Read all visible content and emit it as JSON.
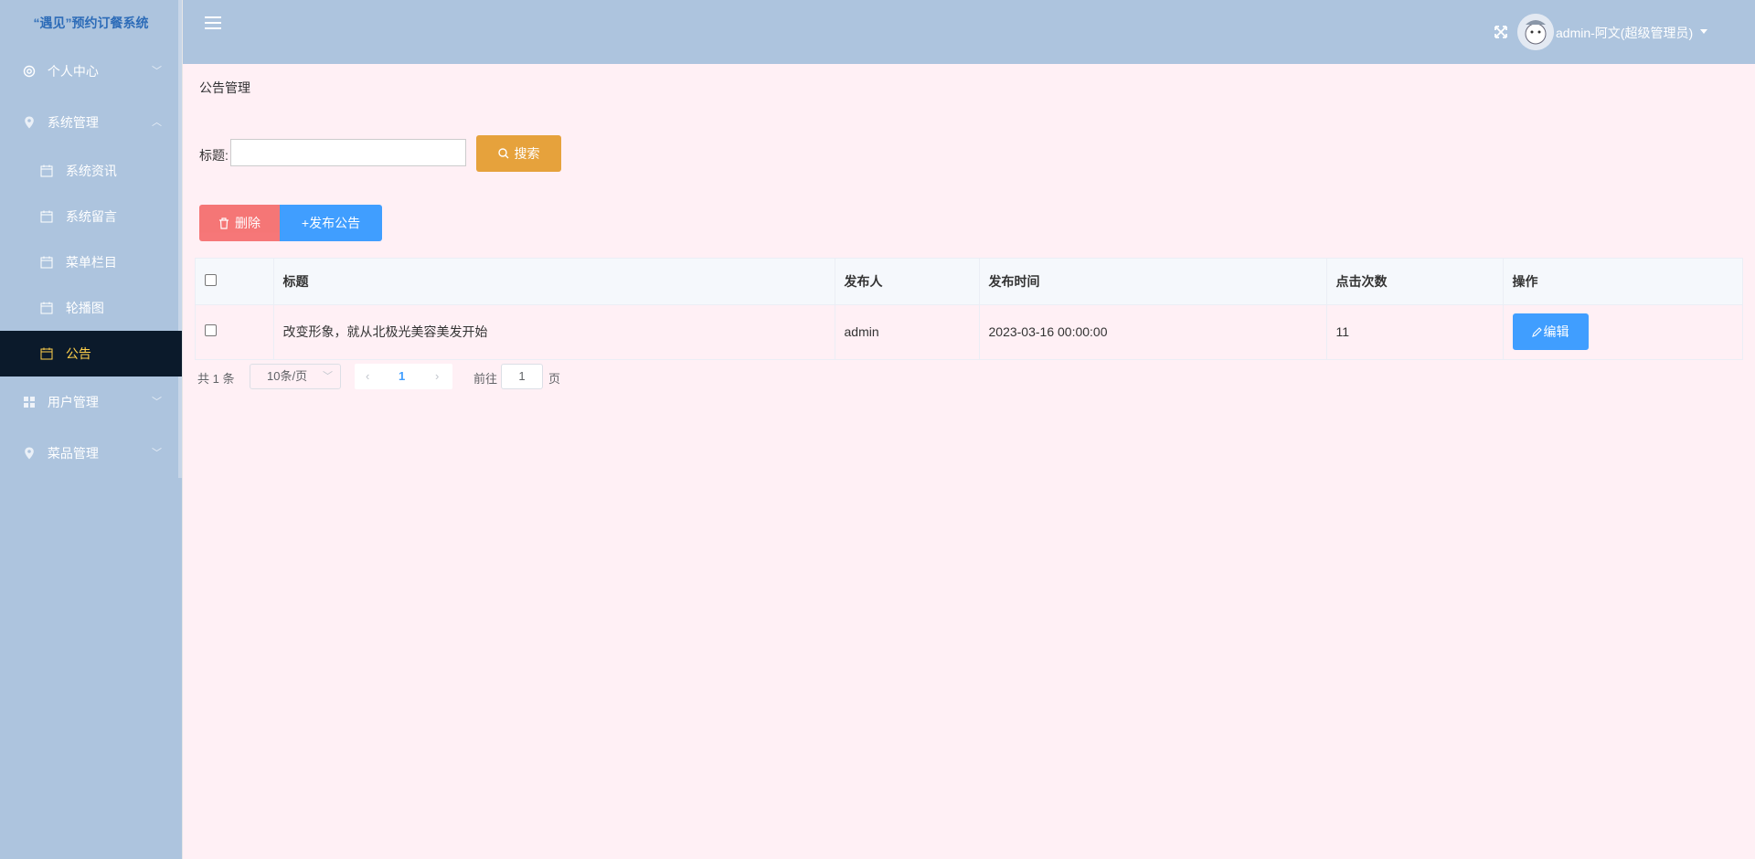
{
  "app": {
    "title": "“遇见”预约订餐系统",
    "user": "admin-阿文(超级管理员)"
  },
  "sidebar": {
    "menus": [
      {
        "label": "个人中心",
        "icon": "gear-icon",
        "arrow": "﹀"
      },
      {
        "label": "系统管理",
        "icon": "location-icon",
        "arrow": "︿"
      }
    ],
    "sub_items": [
      {
        "label": "系统资讯",
        "icon": "calendar-icon"
      },
      {
        "label": "系统留言",
        "icon": "calendar-icon"
      },
      {
        "label": "菜单栏目",
        "icon": "calendar-icon"
      },
      {
        "label": "轮播图",
        "icon": "calendar-icon"
      },
      {
        "label": "公告",
        "icon": "calendar-icon",
        "active": true
      }
    ],
    "menus_after": [
      {
        "label": "用户管理",
        "icon": "grid-icon",
        "arrow": "﹀"
      },
      {
        "label": "菜品管理",
        "icon": "location-icon",
        "arrow": "﹀"
      }
    ]
  },
  "breadcrumb": "公告管理",
  "search": {
    "label": "标题:",
    "value": "",
    "button": "搜索"
  },
  "actions": {
    "delete": "删除",
    "add": "+发布公告"
  },
  "table": {
    "headers": [
      "标题",
      "发布人",
      "发布时间",
      "点击次数",
      "操作"
    ],
    "rows": [
      {
        "title": "改变形象，就从北极光美容美发开始",
        "publisher": "admin",
        "time": "2023-03-16 00:00:00",
        "clicks": "11",
        "action": "编辑"
      }
    ]
  },
  "pagination": {
    "total": "共 1 条",
    "page_size": "10条/页",
    "current": "1",
    "goto_label": "前往",
    "goto_value": "1",
    "page_unit": "页",
    "prev": "‹",
    "next": "›"
  },
  "colors": {
    "sidebar_bg": "#adc4de",
    "active_bg": "#0b1a2b",
    "active_text": "#ffd04b",
    "main_bg": "#fff0f5",
    "primary": "#409eff",
    "warning": "#e6a23c",
    "danger": "#f56c6c"
  }
}
